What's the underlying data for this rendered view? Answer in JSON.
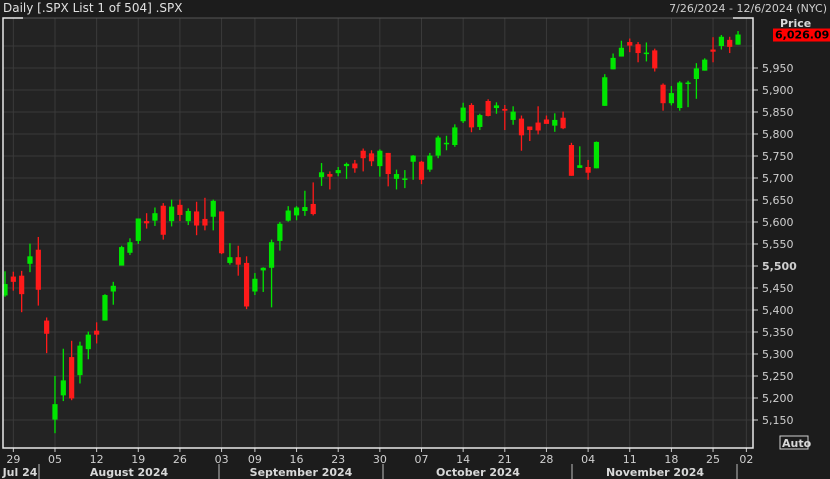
{
  "header": {
    "title": "Daily [.SPX List 1 of 504] .SPX",
    "date_range": "7/26/2024 - 12/6/2024 (NYC)"
  },
  "axis": {
    "price_label": "Price",
    "last_price": "6,026.09",
    "auto_label": "Auto"
  },
  "colors": {
    "up": "#00e600",
    "down": "#ff1a1a",
    "last_price_bg": "#ff0000",
    "grid": "#3a3a3a",
    "plot_bg": "#232323"
  },
  "chart_data": {
    "type": "candlestick",
    "ylim": [
      5120,
      6060
    ],
    "yticks": [
      5150,
      5200,
      5250,
      5300,
      5350,
      5400,
      5450,
      5500,
      5550,
      5600,
      5650,
      5700,
      5750,
      5800,
      5850,
      5900,
      5950
    ],
    "ytick_labels": [
      "5,150",
      "5,200",
      "5,250",
      "5,300",
      "5,350",
      "5,400",
      "5,450",
      "5,500",
      "5,550",
      "5,600",
      "5,650",
      "5,700",
      "5,750",
      "5,800",
      "5,850",
      "5,900",
      "5,950"
    ],
    "xtick_labels": [
      "29",
      "05",
      "12",
      "19",
      "26",
      "03",
      "09",
      "16",
      "23",
      "30",
      "07",
      "14",
      "21",
      "28",
      "04",
      "11",
      "18",
      "25",
      "02"
    ],
    "months": [
      "Jul 24",
      "August 2024",
      "September 2024",
      "October 2024",
      "November 2024"
    ],
    "grid": true,
    "candles": [
      [
        "2024-07-26",
        5433,
        5488,
        5430,
        5459
      ],
      [
        "2024-07-29",
        5476,
        5487,
        5444,
        5464
      ],
      [
        "2024-07-30",
        5478,
        5489,
        5395,
        5436
      ],
      [
        "2024-07-31",
        5505,
        5551,
        5486,
        5522
      ],
      [
        "2024-08-01",
        5537,
        5566,
        5410,
        5446
      ],
      [
        "2024-08-02",
        5376,
        5383,
        5302,
        5346
      ],
      [
        "2024-08-05",
        5151,
        5250,
        5120,
        5186
      ],
      [
        "2024-08-06",
        5206,
        5312,
        5193,
        5240
      ],
      [
        "2024-08-07",
        5293,
        5330,
        5195,
        5199
      ],
      [
        "2024-08-08",
        5252,
        5328,
        5233,
        5319
      ],
      [
        "2024-08-09",
        5311,
        5351,
        5288,
        5344
      ],
      [
        "2024-08-12",
        5353,
        5372,
        5324,
        5344
      ],
      [
        "2024-08-13",
        5376,
        5436,
        5376,
        5434
      ],
      [
        "2024-08-14",
        5442,
        5464,
        5412,
        5455
      ],
      [
        "2024-08-15",
        5501,
        5546,
        5501,
        5543
      ],
      [
        "2024-08-16",
        5530,
        5563,
        5525,
        5554
      ],
      [
        "2024-08-19",
        5557,
        5608,
        5550,
        5608
      ],
      [
        "2024-08-20",
        5602,
        5620,
        5585,
        5597
      ],
      [
        "2024-08-21",
        5603,
        5633,
        5591,
        5620
      ],
      [
        "2024-08-22",
        5637,
        5643,
        5560,
        5571
      ],
      [
        "2024-08-23",
        5602,
        5651,
        5590,
        5635
      ],
      [
        "2024-08-26",
        5639,
        5651,
        5602,
        5616
      ],
      [
        "2024-08-27",
        5602,
        5631,
        5593,
        5625
      ],
      [
        "2024-08-28",
        5624,
        5646,
        5570,
        5592
      ],
      [
        "2024-08-29",
        5607,
        5655,
        5581,
        5592
      ],
      [
        "2024-08-30",
        5612,
        5651,
        5581,
        5648
      ],
      [
        "2024-09-03",
        5624,
        5624,
        5527,
        5529
      ],
      [
        "2024-09-04",
        5507,
        5552,
        5503,
        5520
      ],
      [
        "2024-09-05",
        5520,
        5546,
        5478,
        5503
      ],
      [
        "2024-09-06",
        5507,
        5522,
        5402,
        5408
      ],
      [
        "2024-09-09",
        5442,
        5484,
        5434,
        5471
      ],
      [
        "2024-09-10",
        5490,
        5497,
        5441,
        5496
      ],
      [
        "2024-09-11",
        5496,
        5560,
        5406,
        5554
      ],
      [
        "2024-09-12",
        5557,
        5600,
        5535,
        5596
      ],
      [
        "2024-09-13",
        5603,
        5636,
        5601,
        5626
      ],
      [
        "2024-09-16",
        5615,
        5636,
        5604,
        5633
      ],
      [
        "2024-09-17",
        5625,
        5671,
        5614,
        5634
      ],
      [
        "2024-09-18",
        5641,
        5690,
        5615,
        5618
      ],
      [
        "2024-09-19",
        5702,
        5734,
        5682,
        5713
      ],
      [
        "2024-09-20",
        5709,
        5715,
        5674,
        5703
      ],
      [
        "2024-09-23",
        5711,
        5725,
        5704,
        5718
      ],
      [
        "2024-09-24",
        5727,
        5735,
        5698,
        5732
      ],
      [
        "2024-09-25",
        5733,
        5741,
        5712,
        5722
      ],
      [
        "2024-09-26",
        5762,
        5767,
        5715,
        5745
      ],
      [
        "2024-09-27",
        5756,
        5763,
        5727,
        5738
      ],
      [
        "2024-09-30",
        5727,
        5765,
        5703,
        5762
      ],
      [
        "2024-10-01",
        5757,
        5757,
        5681,
        5709
      ],
      [
        "2024-10-02",
        5698,
        5719,
        5674,
        5709
      ],
      [
        "2024-10-03",
        5698,
        5718,
        5677,
        5699
      ],
      [
        "2024-10-04",
        5737,
        5752,
        5696,
        5751
      ],
      [
        "2024-10-07",
        5737,
        5739,
        5686,
        5696
      ],
      [
        "2024-10-08",
        5719,
        5757,
        5714,
        5751
      ],
      [
        "2024-10-09",
        5751,
        5796,
        5745,
        5792
      ],
      [
        "2024-10-10",
        5778,
        5796,
        5763,
        5780
      ],
      [
        "2024-10-11",
        5775,
        5822,
        5771,
        5815
      ],
      [
        "2024-10-14",
        5829,
        5871,
        5825,
        5860
      ],
      [
        "2024-10-15",
        5866,
        5870,
        5804,
        5815
      ],
      [
        "2024-10-16",
        5816,
        5846,
        5809,
        5843
      ],
      [
        "2024-10-17",
        5875,
        5879,
        5840,
        5841
      ],
      [
        "2024-10-18",
        5859,
        5872,
        5846,
        5865
      ],
      [
        "2024-10-21",
        5857,
        5866,
        5809,
        5853
      ],
      [
        "2024-10-22",
        5832,
        5863,
        5821,
        5851
      ],
      [
        "2024-10-23",
        5835,
        5842,
        5762,
        5797
      ],
      [
        "2024-10-24",
        5817,
        5817,
        5784,
        5809
      ],
      [
        "2024-10-25",
        5826,
        5863,
        5799,
        5808
      ],
      [
        "2024-10-28",
        5833,
        5842,
        5823,
        5823
      ],
      [
        "2024-10-29",
        5819,
        5847,
        5805,
        5832
      ],
      [
        "2024-10-30",
        5837,
        5851,
        5811,
        5813
      ],
      [
        "2024-10-31",
        5775,
        5780,
        5705,
        5705
      ],
      [
        "2024-11-01",
        5723,
        5772,
        5723,
        5729
      ],
      [
        "2024-11-04",
        5725,
        5741,
        5696,
        5712
      ],
      [
        "2024-11-05",
        5722,
        5783,
        5722,
        5782
      ],
      [
        "2024-11-06",
        5864,
        5936,
        5864,
        5929
      ],
      [
        "2024-11-07",
        5947,
        5983,
        5947,
        5973
      ],
      [
        "2024-11-08",
        5976,
        6012,
        5976,
        5996
      ],
      [
        "2024-11-11",
        6009,
        6017,
        5986,
        6001
      ],
      [
        "2024-11-12",
        6004,
        6009,
        5963,
        5984
      ],
      [
        "2024-11-13",
        5985,
        6008,
        5965,
        5985
      ],
      [
        "2024-11-14",
        5990,
        5994,
        5942,
        5949
      ],
      [
        "2024-11-15",
        5912,
        5915,
        5853,
        5870
      ],
      [
        "2024-11-18",
        5870,
        5909,
        5865,
        5893
      ],
      [
        "2024-11-19",
        5859,
        5920,
        5853,
        5917
      ],
      [
        "2024-11-20",
        5917,
        5921,
        5861,
        5917
      ],
      [
        "2024-11-21",
        5925,
        5961,
        5880,
        5949
      ],
      [
        "2024-11-22",
        5944,
        5972,
        5944,
        5969
      ],
      [
        "2024-11-25",
        5992,
        6020,
        5963,
        5987
      ],
      [
        "2024-11-26",
        6000,
        6025,
        5992,
        6021
      ],
      [
        "2024-11-27",
        6014,
        6021,
        5984,
        5998
      ],
      [
        "2024-11-29",
        6003,
        6034,
        6003,
        6026.09
      ]
    ]
  }
}
